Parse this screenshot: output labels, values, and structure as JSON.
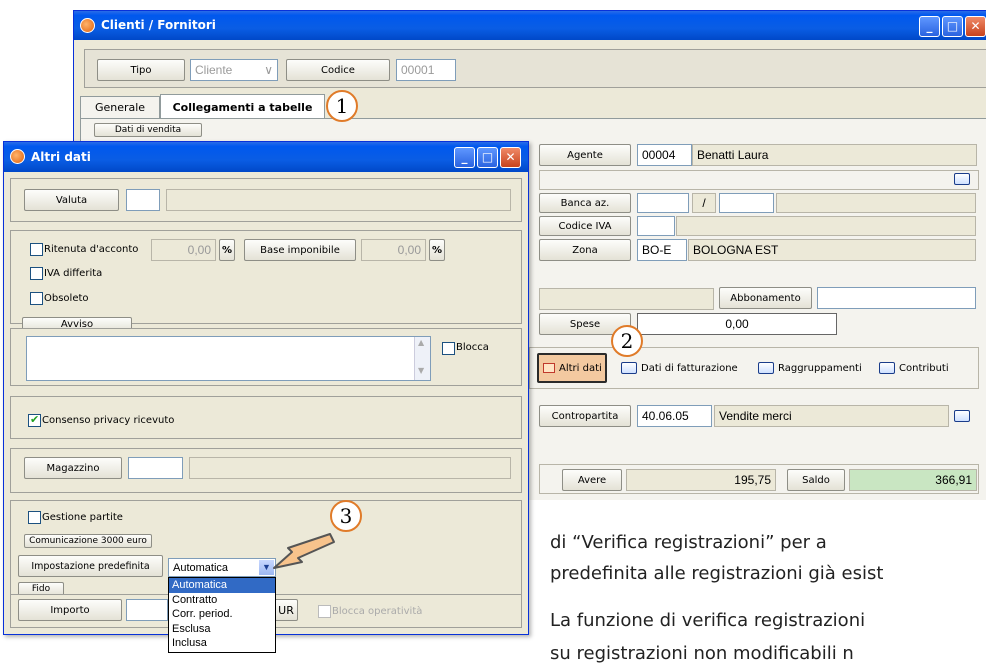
{
  "main_window": {
    "title": "Clienti / Fornitori",
    "tipo_label": "Tipo",
    "tipo_value": "Cliente",
    "codice_label": "Codice",
    "codice_value": "00001",
    "tabs": [
      "Generale",
      "Collegamenti a tabelle"
    ],
    "group_label": "Dati di vendita",
    "agente_label": "Agente",
    "agente_code": "00004",
    "agente_name": "Benatti Laura",
    "banca_label": "Banca az.",
    "banca_sep": "/",
    "codice_iva_label": "Codice IVA",
    "zona_label": "Zona",
    "zona_code": "BO-E",
    "zona_name": "BOLOGNA EST",
    "abbonamento_label": "Abbonamento",
    "spese_label": "Spese",
    "spese_value": "0,00",
    "buttons": [
      "Altri dati",
      "Dati di fatturazione",
      "Raggruppamenti",
      "Contributi"
    ],
    "contropartita_label": "Contropartita",
    "contropartita_code": "40.06.05",
    "contropartita_name": "Vendite merci",
    "avere_label": "Avere",
    "avere_value": "195,75",
    "saldo_label": "Saldo",
    "saldo_value": "366,91"
  },
  "dialog": {
    "title": "Altri dati",
    "valuta_label": "Valuta",
    "ritenuta_label": "Ritenuta d'acconto",
    "ritenuta_value": "0,00",
    "percent": "%",
    "base_label": "Base imponibile",
    "base_value": "0,00",
    "iva_differita_label": "IVA differita",
    "obsoleto_label": "Obsoleto",
    "avviso_label": "Avviso",
    "blocca_label": "Blocca",
    "privacy_label": "Consenso privacy ricevuto",
    "magazzino_label": "Magazzino",
    "gestione_partite_label": "Gestione partite",
    "comunicazione_label": "Comunicazione 3000 euro",
    "impostazione_label": "Impostazione predefinita",
    "impostazione_value": "Automatica",
    "dropdown_options": [
      "Automatica",
      "Contratto",
      "Corr. period.",
      "Esclusa",
      "Inclusa"
    ],
    "fido_label": "Fido",
    "importo_label": "Importo",
    "eur_label": "UR",
    "blocca_operativita_label": "Blocca operatività"
  },
  "callouts": [
    "1",
    "2",
    "3"
  ],
  "prose": {
    "line1": "di  “Verifica  registrazioni”  per  a",
    "line2": "predefinita alle registrazioni già esist",
    "line3": "La funzione di verifica registrazioni",
    "line4": "su registrazioni non modificabili n"
  },
  "colors": {
    "titlebar": "#0A5DE4",
    "window_bg": "#ECE9D8",
    "callout_border": "#E07B29",
    "saldo_bg": "#C9E6C2",
    "dropdown_highlight": "#316AC5"
  }
}
